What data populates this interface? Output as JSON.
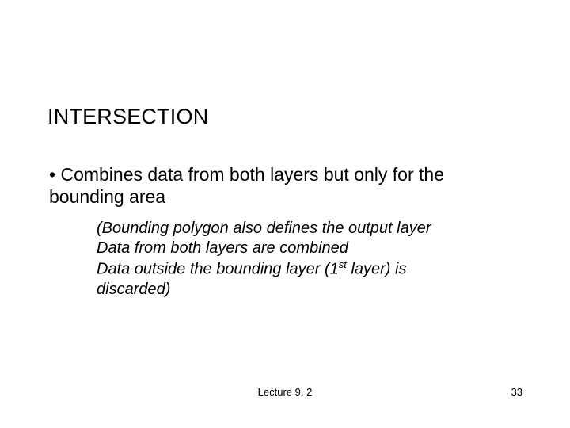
{
  "title": "INTERSECTION",
  "bullet": {
    "marker": "•",
    "line1": "Combines data from both layers but only for the",
    "line2": "bounding area"
  },
  "sub": {
    "line1": "(Bounding polygon also defines the output layer",
    "line2": "Data from both layers are combined",
    "line3_pre": "Data outside the bounding layer (1",
    "line3_sup": "st",
    "line3_post": " layer) is",
    "line4": "discarded)"
  },
  "footer": {
    "center": "Lecture 9. 2",
    "page": "33"
  }
}
